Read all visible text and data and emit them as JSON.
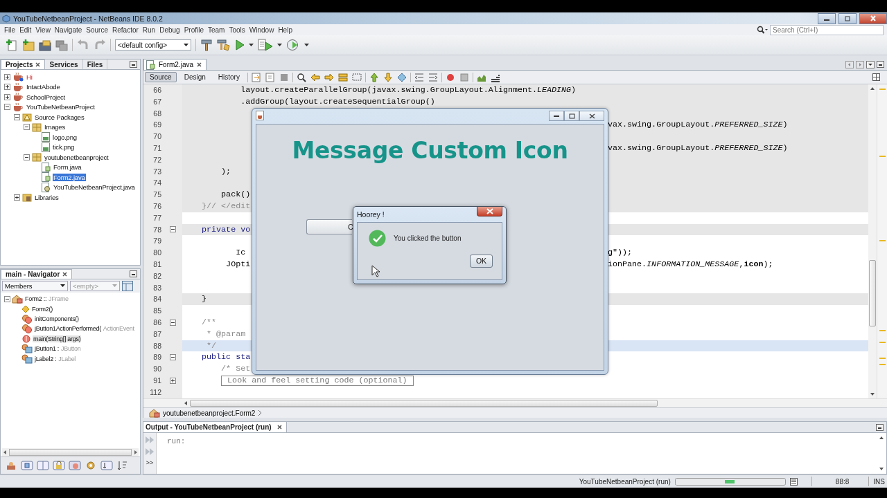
{
  "window": {
    "title": "YouTubeNetbeanProject - NetBeans IDE 8.0.2"
  },
  "menu": [
    "File",
    "Edit",
    "View",
    "Navigate",
    "Source",
    "Refactor",
    "Run",
    "Debug",
    "Profile",
    "Team",
    "Tools",
    "Window",
    "Help"
  ],
  "search": {
    "placeholder": "Search (Ctrl+I)"
  },
  "toolbar": {
    "config": "<default config>"
  },
  "projects_panel": {
    "tabs": [
      {
        "label": "Projects",
        "selected": true
      },
      {
        "label": "Services",
        "selected": false
      },
      {
        "label": "Files",
        "selected": false
      }
    ],
    "tree": [
      {
        "label": "Hi",
        "kind": "project",
        "error": true,
        "expanded": false,
        "selected": false
      },
      {
        "label": "IntactAbode",
        "kind": "project",
        "error": false,
        "expanded": false,
        "selected": false
      },
      {
        "label": "SchoolProject",
        "kind": "project",
        "error": false,
        "expanded": false,
        "selected": false
      },
      {
        "label": "YouTubeNetbeanProject",
        "kind": "project",
        "error": false,
        "expanded": true,
        "selected": false,
        "children": [
          {
            "label": "Source Packages",
            "kind": "source-root",
            "expanded": true,
            "selected": false,
            "children": [
              {
                "label": "Images",
                "kind": "package",
                "expanded": true,
                "selected": false,
                "children": [
                  {
                    "label": "logo.png",
                    "kind": "image",
                    "selected": false
                  },
                  {
                    "label": "tick.png",
                    "kind": "image",
                    "selected": false
                  }
                ]
              },
              {
                "label": "youtubenetbeanproject",
                "kind": "package",
                "expanded": true,
                "selected": false,
                "children": [
                  {
                    "label": "Form.java",
                    "kind": "form",
                    "selected": false
                  },
                  {
                    "label": "Form2.java",
                    "kind": "form",
                    "selected": true
                  },
                  {
                    "label": "YouTubeNetbeanProject.java",
                    "kind": "main-class",
                    "selected": false
                  }
                ]
              }
            ]
          },
          {
            "label": "Libraries",
            "kind": "library",
            "expanded": false,
            "selected": false
          }
        ]
      }
    ]
  },
  "navigator": {
    "title": "main - Navigator",
    "filter": "Members",
    "filter_secondary": "<empty>",
    "tree": [
      {
        "name": "Form2 ::",
        "type": "JFrame",
        "kind": "class",
        "expanded": true,
        "selected": false,
        "children": [
          {
            "name": "Form2()",
            "kind": "constructor",
            "selected": false
          },
          {
            "name": "initComponents()",
            "kind": "method",
            "selected": false
          },
          {
            "name": "jButton1ActionPerformed(",
            "type": "ActionEvent",
            "kind": "method",
            "selected": false
          },
          {
            "name": "main(String[] args)",
            "kind": "static-method",
            "selected": true
          },
          {
            "name": "jButton1 :",
            "type": "JButton",
            "kind": "field",
            "selected": false
          },
          {
            "name": "jLabel2 :",
            "type": "JLabel",
            "kind": "field",
            "selected": false
          }
        ]
      }
    ]
  },
  "editor": {
    "tab": "Form2.java",
    "views": [
      {
        "label": "Source",
        "selected": true
      },
      {
        "label": "Design",
        "selected": false
      },
      {
        "label": "History",
        "selected": false
      }
    ],
    "lines": [
      {
        "number": "66",
        "code": "            layout.createParallelGroup(javax.swing.GroupLayout.Alignment.*LEADING*)",
        "kind": "code",
        "highlighted": true,
        "current": false
      },
      {
        "number": "67",
        "code": "            .addGroup(layout.createSequentialGroup()",
        "kind": "code",
        "highlighted": true,
        "current": false
      },
      {
        "number": "68",
        "highlighted": true,
        "current": false
      },
      {
        "number": "69",
        "right": "vax.swing.GroupLayout.*PREFERRED_SIZE*)",
        "highlighted": true,
        "current": false
      },
      {
        "number": "70",
        "highlighted": true,
        "current": false
      },
      {
        "number": "71",
        "right": "vax.swing.GroupLayout.*PREFERRED_SIZE*)",
        "highlighted": true,
        "current": false
      },
      {
        "number": "72",
        "highlighted": true,
        "current": false
      },
      {
        "number": "73",
        "code": "        );",
        "kind": "code",
        "highlighted": true,
        "current": false
      },
      {
        "number": "74",
        "highlighted": true,
        "current": false
      },
      {
        "number": "75",
        "code": "        pack()",
        "kind": "code",
        "highlighted": true,
        "current": false
      },
      {
        "number": "76",
        "code": "    }// </edit",
        "kind": "comment",
        "highlighted": true,
        "current": false
      },
      {
        "number": "77",
        "highlighted": false,
        "current": false
      },
      {
        "number": "78",
        "code": "    private vo",
        "kind": "keyword",
        "highlighted": true,
        "current": false,
        "folded": false
      },
      {
        "number": "79",
        "highlighted": false,
        "current": false
      },
      {
        "number": "80",
        "code": "           Ic",
        "kind": "code",
        "right": "g\"));",
        "highlighted": false,
        "current": false
      },
      {
        "number": "81",
        "code": "         JOpti",
        "kind": "code",
        "right": "ionPane.*INFORMATION_MESSAGE*,**icon**);",
        "highlighted": false,
        "current": false
      },
      {
        "number": "82",
        "highlighted": false,
        "current": false
      },
      {
        "number": "83",
        "highlighted": false,
        "current": false
      },
      {
        "number": "84",
        "code": "    }",
        "kind": "code",
        "highlighted": true,
        "current": false
      },
      {
        "number": "85",
        "highlighted": false,
        "current": false
      },
      {
        "number": "86",
        "code": "    /**",
        "kind": "comment",
        "highlighted": false,
        "current": false,
        "folded": false
      },
      {
        "number": "87",
        "code": "     * @param",
        "kind": "comment",
        "highlighted": false,
        "current": false
      },
      {
        "number": "88",
        "code": "     */",
        "kind": "comment",
        "highlighted": false,
        "current": true
      },
      {
        "number": "89",
        "code": "    public sta",
        "kind": "keyword",
        "highlighted": false,
        "current": false,
        "folded": false
      },
      {
        "number": "90",
        "code": "        /* Set",
        "kind": "comment",
        "highlighted": false,
        "current": false
      },
      {
        "number": "91",
        "code": "        Look and feel setting code (optional)",
        "kind": "folded",
        "highlighted": false,
        "current": false,
        "folded": true
      },
      {
        "number": "112",
        "highlighted": false,
        "current": false
      }
    ],
    "breadcrumb": "youtubenetbeanproject.Form2"
  },
  "form_window": {
    "heading": "Message Custom Icon",
    "button": "C"
  },
  "dialog": {
    "title": "Hoorey !",
    "message": "You clicked the button",
    "button": "OK"
  },
  "output": {
    "title": "Output - YouTubeNetbeanProject (run)",
    "lines": [
      "run:"
    ],
    "overflow": ">>"
  },
  "status_bar": {
    "task": "YouTubeNetbeanProject (run)",
    "position": "88:8",
    "mode": "INS"
  }
}
